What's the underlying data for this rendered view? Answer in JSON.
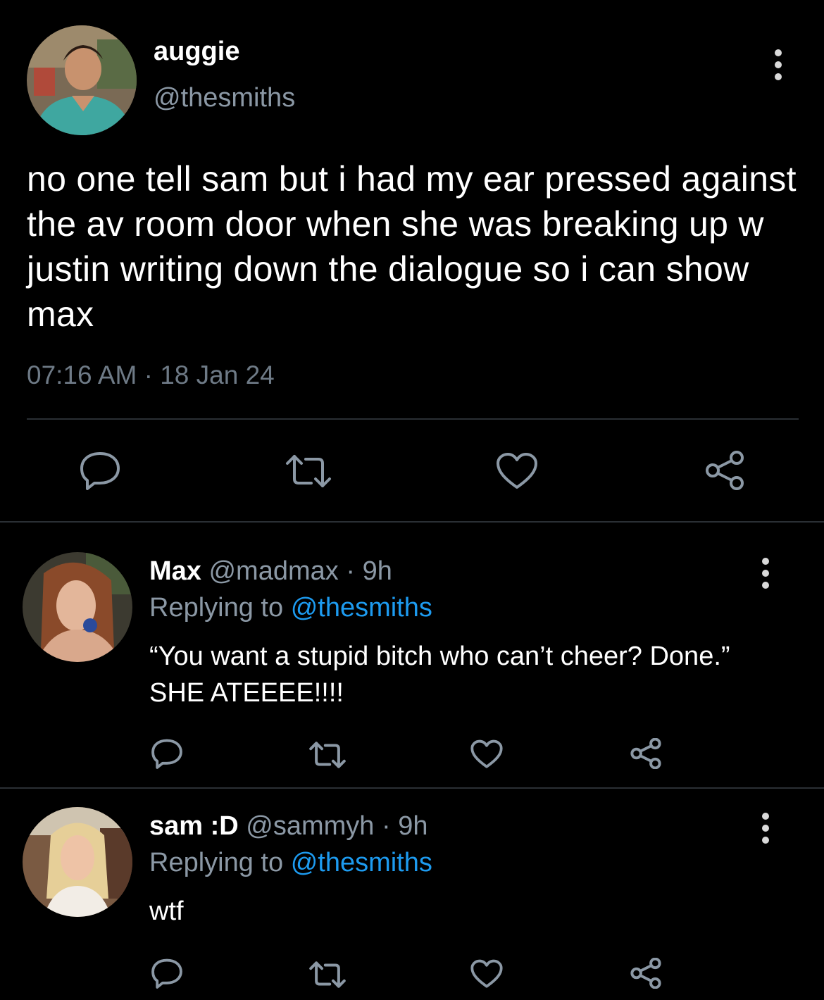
{
  "tweet": {
    "author_name": "auggie",
    "author_handle": "@thesmiths",
    "text": "no one tell sam but i had my ear pressed against the av room door when she was breaking up w justin writing down the dialogue so i can show max",
    "timestamp": "07:16 AM · 18 Jan 24",
    "actions": [
      "reply-icon",
      "retweet-icon",
      "like-icon",
      "share-icon"
    ]
  },
  "replies": [
    {
      "name": "Max",
      "handle": "@madmax",
      "sep": "·",
      "age": "9h",
      "replying_prefix": "Replying to",
      "replying_to": "@thesmiths",
      "text": "“You want a stupid bitch who can’t cheer? Done.” SHE ATEEEE!!!!"
    },
    {
      "name": "sam :D",
      "handle": "@sammyh",
      "sep": "·",
      "age": "9h",
      "replying_prefix": "Replying to",
      "replying_to": "@thesmiths",
      "text": "wtf"
    }
  ],
  "colors": {
    "background": "#000000",
    "secondary_text": "#8b98a5",
    "link": "#1d9bf0",
    "icon": "#8b98a5"
  }
}
